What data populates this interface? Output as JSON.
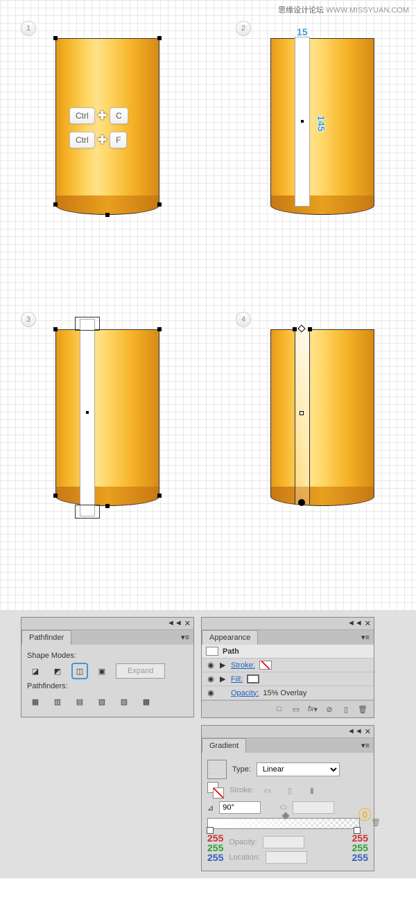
{
  "watermark": {
    "cn": "思缘设计论坛",
    "url": "WWW.MISSYUAN.COM"
  },
  "steps": {
    "s1": "1",
    "s2": "2",
    "s3": "3",
    "s4": "4"
  },
  "keys": {
    "ctrl": "Ctrl",
    "c": "C",
    "f": "F"
  },
  "dims": {
    "w": "15",
    "h": "145"
  },
  "pathfinder": {
    "title": "Pathfinder",
    "shape_modes": "Shape Modes:",
    "pathfinders": "Pathfinders:",
    "expand": "Expand"
  },
  "appearance": {
    "title": "Appearance",
    "path": "Path",
    "stroke": "Stroke:",
    "fill": "Fill:",
    "opacity_lbl": "Opacity:",
    "opacity_val": "15% Overlay"
  },
  "gradient": {
    "title": "Gradient",
    "type_lbl": "Type:",
    "type_val": "Linear",
    "stroke_lbl": "Stroke:",
    "angle": "90°",
    "opacity_lbl": "Opacity:",
    "location_lbl": "Location:",
    "ratio": "0",
    "left": {
      "r": "255",
      "g": "255",
      "b": "255"
    },
    "right": {
      "r": "255",
      "g": "255",
      "b": "255"
    }
  }
}
